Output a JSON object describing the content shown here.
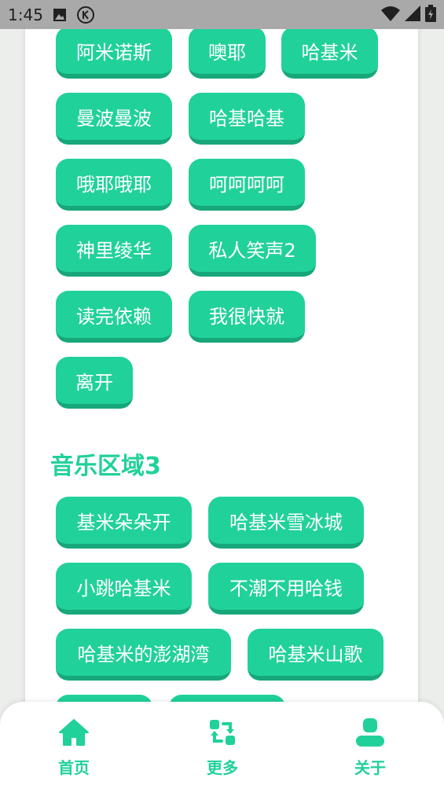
{
  "status_bar": {
    "time": "1:45"
  },
  "section2_buttons": [
    "阿米诺斯",
    "噢耶",
    "哈基米",
    "曼波曼波",
    "哈基哈基",
    "哦耶哦耶",
    "呵呵呵呵",
    "神里绫华",
    "私人笑声2",
    "读完依赖",
    "我很快就",
    "离开"
  ],
  "section3": {
    "title": "音乐区域3",
    "buttons": [
      "基米朵朵开",
      "哈基米雪冰城",
      "小跳哈基米",
      "不潮不用哈钱",
      "哈基米的澎湖湾",
      "哈基米山歌"
    ]
  },
  "bottom_nav": [
    {
      "label": "首页",
      "icon": "home-icon"
    },
    {
      "label": "更多",
      "icon": "refresh-icon"
    },
    {
      "label": "关于",
      "icon": "user-icon"
    }
  ],
  "colors": {
    "accent": "#21d19a",
    "accent_dark": "#17a77a",
    "status_bar": "#a9a9a9"
  }
}
